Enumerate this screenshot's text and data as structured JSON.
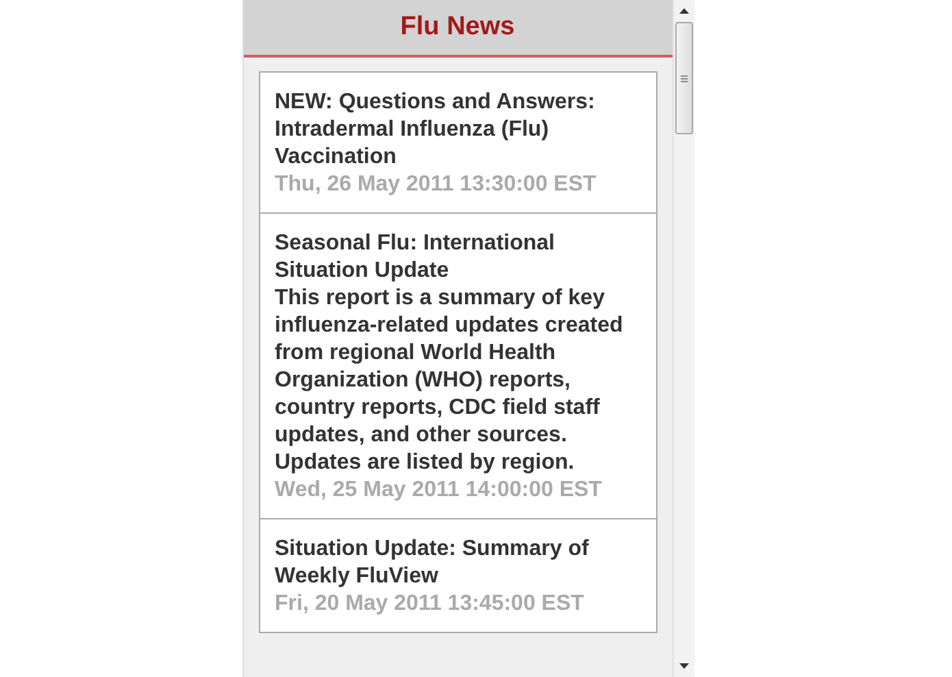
{
  "header": {
    "title": "Flu News"
  },
  "news_items": [
    {
      "title": "NEW: Questions and Answers: Intradermal Influenza (Flu) Vaccination",
      "date": "Thu, 26 May 2011 13:30:00 EST"
    },
    {
      "title": "Seasonal Flu: International Situation Update",
      "description": "This report is a summary of key influenza-related updates created from regional World Health Organization (WHO) reports, country reports, CDC field staff updates, and other sources. Updates are listed by region.",
      "date": "Wed, 25 May 2011 14:00:00 EST"
    },
    {
      "title": "Situation Update: Summary of Weekly FluView",
      "date": "Fri, 20 May 2011 13:45:00 EST"
    }
  ]
}
